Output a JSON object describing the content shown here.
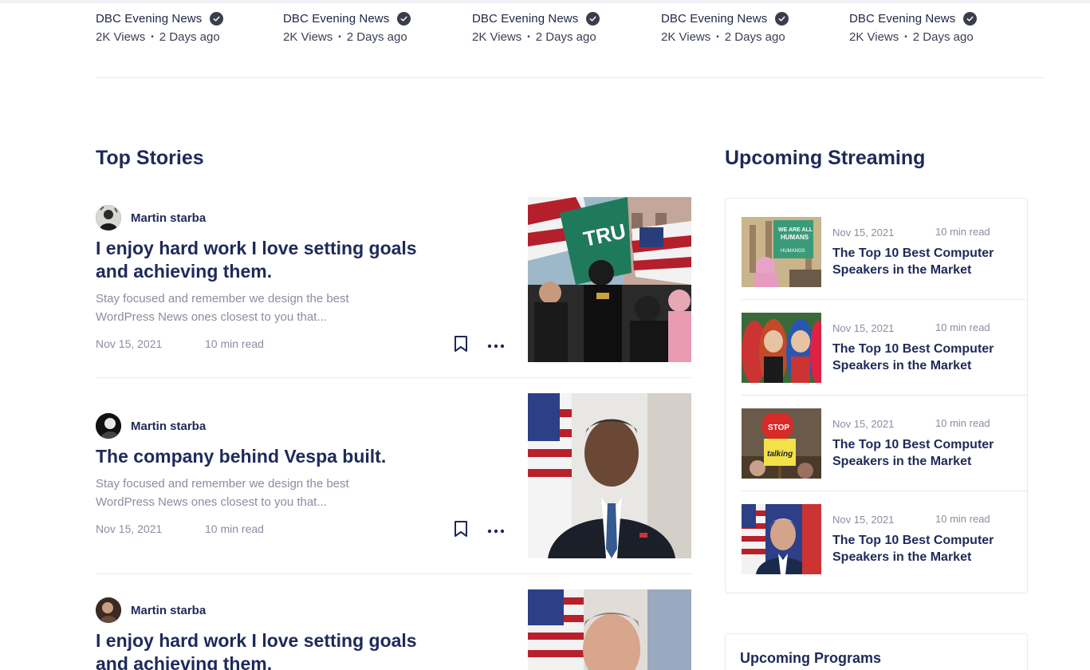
{
  "channels": [
    {
      "name": "DBC Evening News",
      "views": "2K Views",
      "age": "2 Days ago"
    },
    {
      "name": "DBC Evening News",
      "views": "2K Views",
      "age": "2 Days ago"
    },
    {
      "name": "DBC Evening News",
      "views": "2K Views",
      "age": "2 Days ago"
    },
    {
      "name": "DBC Evening News",
      "views": "2K Views",
      "age": "2 Days ago"
    },
    {
      "name": "DBC Evening News",
      "views": "2K Views",
      "age": "2 Days ago"
    }
  ],
  "top_stories": {
    "title": "Top Stories",
    "items": [
      {
        "author": "Martin starba",
        "title": "I enjoy hard work I love setting goals and achieving them.",
        "excerpt": "Stay focused and remember we design the best WordPress News  ones closest to you that...",
        "date": "Nov 15, 2021",
        "read_time": "10 min read"
      },
      {
        "author": "Martin starba",
        "title": "The company behind Vespa built.",
        "excerpt": "Stay focused and remember we design the best WordPress News  ones closest to you that...",
        "date": "Nov 15, 2021",
        "read_time": "10 min read"
      },
      {
        "author": "Martin starba",
        "title": "I enjoy hard work I love setting goals and achieving them.",
        "excerpt": "",
        "date": "",
        "read_time": ""
      }
    ]
  },
  "streaming": {
    "title": "Upcoming Streaming",
    "items": [
      {
        "date": "Nov 15, 2021",
        "read_time": "10 min read",
        "title": "The Top 10 Best Computer Speakers in the Market"
      },
      {
        "date": "Nov 15, 2021",
        "read_time": "10 min read",
        "title": "The Top 10 Best Computer Speakers in the Market"
      },
      {
        "date": "Nov 15, 2021",
        "read_time": "10 min read",
        "title": "The Top 10 Best Computer Speakers in the Market"
      },
      {
        "date": "Nov 15, 2021",
        "read_time": "10 min read",
        "title": "The Top 10 Best Computer Speakers in the Market"
      }
    ]
  },
  "programs": {
    "title": "Upcoming Programs"
  },
  "icons": {
    "verified": "check-circle-icon",
    "bookmark": "bookmark-icon",
    "more": "more-horizontal-icon"
  },
  "colors": {
    "heading": "#1e2a5a",
    "muted": "#8a8d9e",
    "border": "#e7e9ee"
  }
}
